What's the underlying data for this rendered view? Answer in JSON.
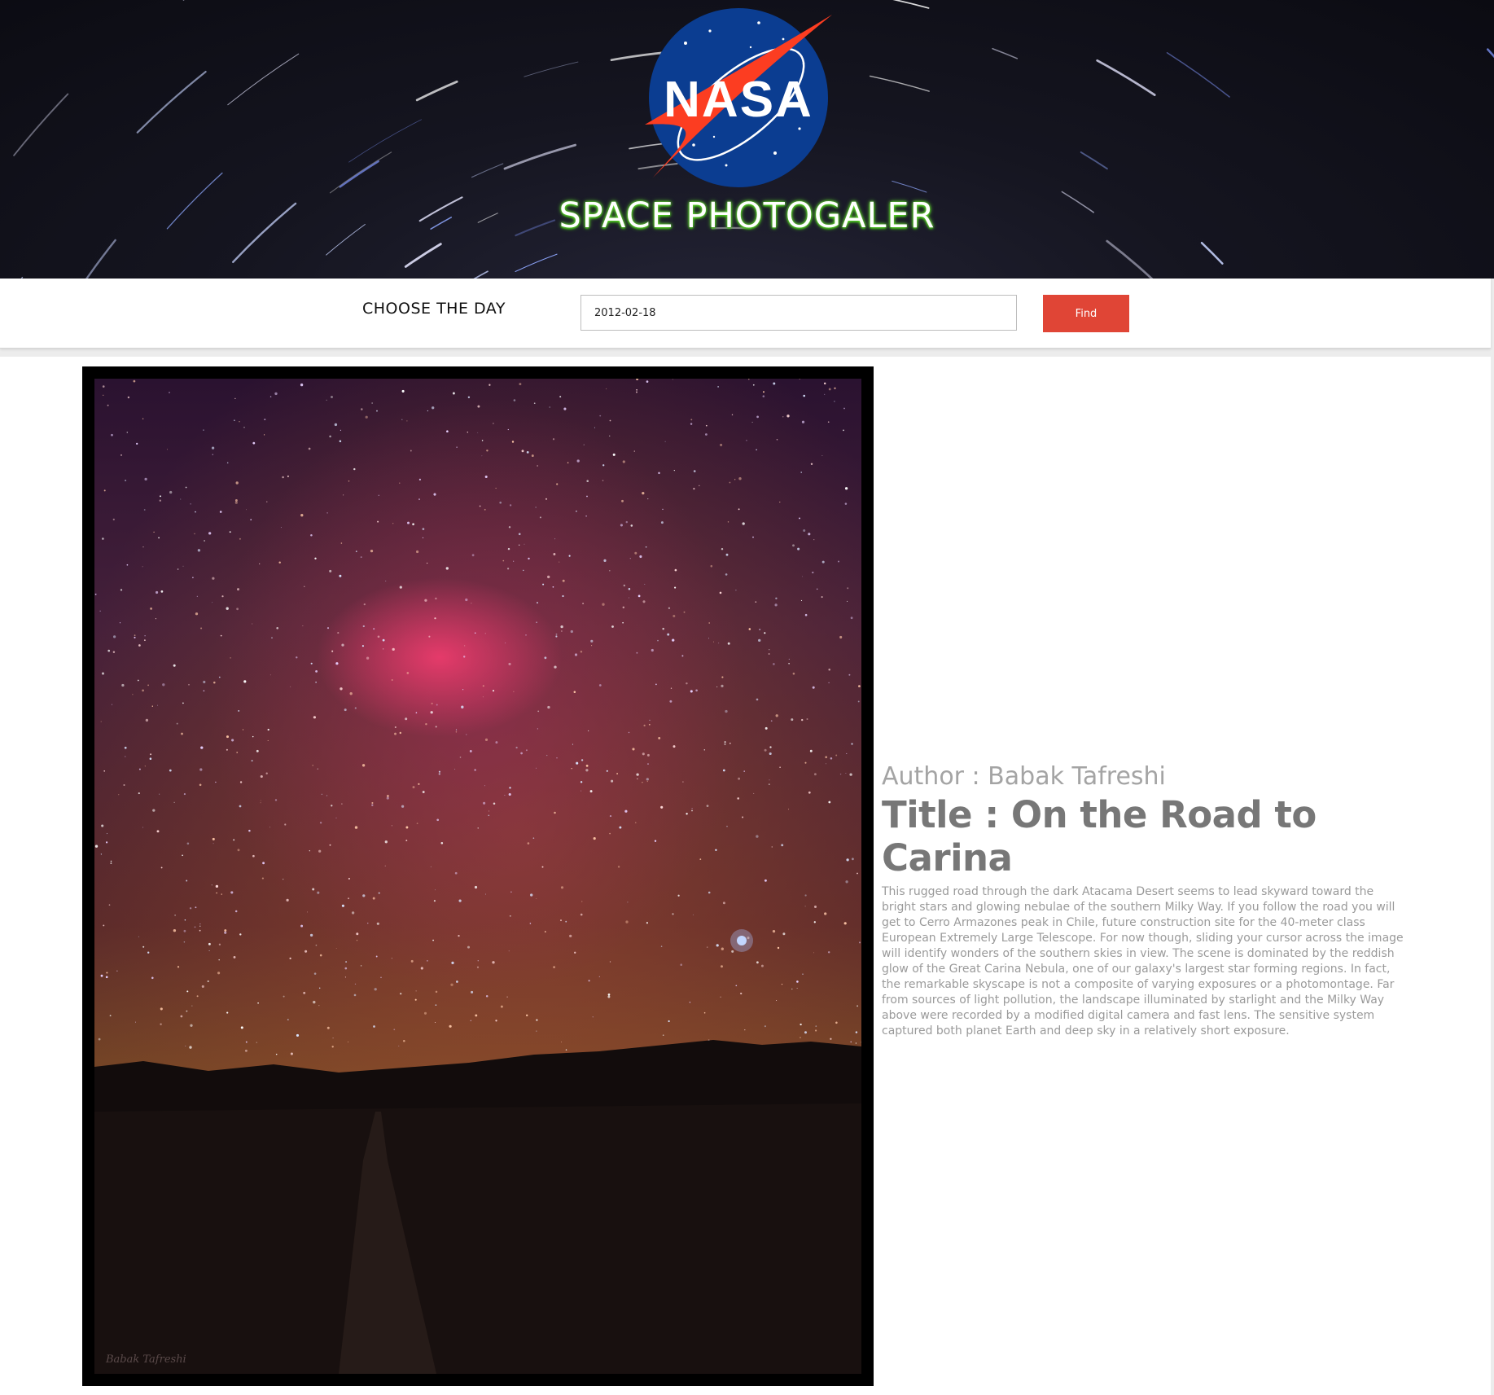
{
  "header": {
    "logo_text": "NASA",
    "site_title": "SPACE PHOTOGALER"
  },
  "date_picker": {
    "label": "CHOOSE THE DAY",
    "value": "2012-02-18",
    "button_label": "Find"
  },
  "photo": {
    "watermark": "Babak Tafreshi",
    "author": "Author : Babak Tafreshi",
    "title": "Title : On the Road to Carina",
    "description": "This rugged road through the dark Atacama Desert seems to lead skyward toward the bright stars and glowing nebulae of the southern Milky Way. If you follow the road you will get to Cerro Armazones peak in Chile, future construction site for the 40-meter class European Extremely Large Telescope. For now though, sliding your cursor across the image will identify wonders of the southern skies in view. The scene is dominated by the reddish glow of the Great Carina Nebula, one of our galaxy's largest star forming regions. In fact, the remarkable skyscape is not a composite of varying exposures or a photomontage. Far from sources of light pollution, the landscape illuminated by starlight and the Milky Way above were recorded by a modified digital camera and fast lens. The sensitive system captured both planet Earth and deep sky in a relatively short exposure."
  },
  "colors": {
    "accent_button": "#e04536",
    "title_glow": "#5fdc2a",
    "nasa_blue": "#0b3d91",
    "nasa_red": "#fc3d21"
  }
}
